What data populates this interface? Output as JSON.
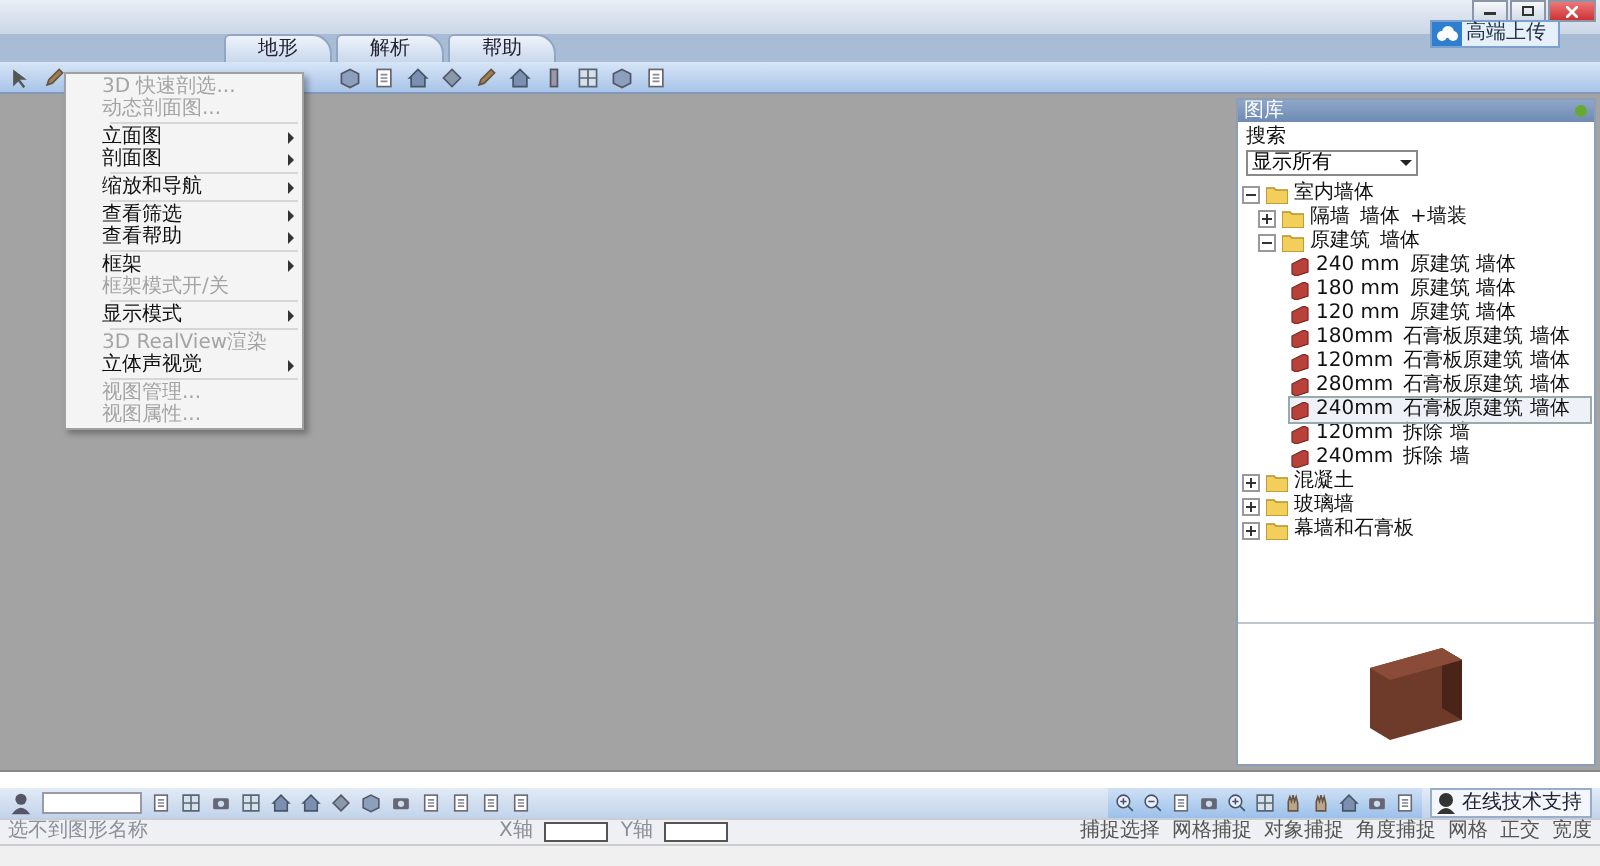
{
  "tabs": [
    {
      "label": "地形",
      "selected": false
    },
    {
      "label": "解析",
      "selected": false
    },
    {
      "label": "帮助",
      "selected": false
    }
  ],
  "upload_button": {
    "label": "高端上传"
  },
  "view_menu": {
    "groups": [
      [
        {
          "label": "3D 快速剖选...",
          "disabled": true,
          "submenu": false
        },
        {
          "label": "动态剖面图...",
          "disabled": true,
          "submenu": false
        }
      ],
      [
        {
          "label": "立面图",
          "disabled": false,
          "submenu": true
        },
        {
          "label": "剖面图",
          "disabled": false,
          "submenu": true
        }
      ],
      [
        {
          "label": "缩放和导航",
          "disabled": false,
          "submenu": true
        }
      ],
      [
        {
          "label": "查看筛选",
          "disabled": false,
          "submenu": true
        },
        {
          "label": "查看帮助",
          "disabled": false,
          "submenu": true
        }
      ],
      [
        {
          "label": "框架",
          "disabled": false,
          "submenu": true
        },
        {
          "label": "框架模式开/关",
          "disabled": true,
          "submenu": false
        }
      ],
      [
        {
          "label": "显示模式",
          "disabled": false,
          "submenu": true
        }
      ],
      [
        {
          "label": "3D RealView渲染",
          "disabled": true,
          "submenu": false
        },
        {
          "label": "立体声视觉",
          "disabled": false,
          "submenu": true
        }
      ],
      [
        {
          "label": "视图管理...",
          "disabled": true,
          "submenu": false
        },
        {
          "label": "视图属性...",
          "disabled": true,
          "submenu": false
        }
      ]
    ]
  },
  "library": {
    "title": "图库",
    "search_label": "搜索",
    "filter": {
      "value": "显示所有"
    },
    "tree": [
      {
        "kind": "folder",
        "label": "室内墙体",
        "expanded": true,
        "children": [
          {
            "kind": "folder",
            "label": "隔墙",
            "cells": [
              "墙体",
              "+墙装"
            ],
            "expanded": false
          },
          {
            "kind": "folder",
            "label": "原建筑",
            "cells": [
              "墙体"
            ],
            "expanded": true,
            "children": [
              {
                "kind": "wall",
                "label": "240 mm",
                "cells": [
                  "原建筑 墙体"
                ],
                "selected": false
              },
              {
                "kind": "wall",
                "label": "180 mm",
                "cells": [
                  "原建筑 墙体"
                ],
                "selected": false
              },
              {
                "kind": "wall",
                "label": "120 mm",
                "cells": [
                  "原建筑 墙体"
                ],
                "selected": false
              },
              {
                "kind": "wall",
                "label": "180mm",
                "cells": [
                  "石膏板原建筑 墙体"
                ],
                "selected": false
              },
              {
                "kind": "wall",
                "label": "120mm",
                "cells": [
                  "石膏板原建筑 墙体"
                ],
                "selected": false
              },
              {
                "kind": "wall",
                "label": "280mm",
                "cells": [
                  "石膏板原建筑 墙体"
                ],
                "selected": false
              },
              {
                "kind": "wall",
                "label": "240mm",
                "cells": [
                  "石膏板原建筑 墙体"
                ],
                "selected": true
              },
              {
                "kind": "wall",
                "label": "120mm",
                "cells": [
                  "拆除 墙"
                ],
                "selected": false
              },
              {
                "kind": "wall",
                "label": "240mm",
                "cells": [
                  "拆除 墙"
                ],
                "selected": false
              }
            ]
          }
        ]
      },
      {
        "kind": "folder",
        "label": "混凝土",
        "expanded": false
      },
      {
        "kind": "folder",
        "label": "玻璃墙",
        "expanded": false
      },
      {
        "kind": "folder",
        "label": "幕墙和石膏板",
        "expanded": false
      }
    ]
  },
  "support_button": {
    "label": "在线技术支持"
  },
  "status_bar": {
    "object_filter": "选不到图形名称",
    "x_label": "X轴",
    "y_label": "Y轴",
    "toggles": [
      "捕捉选择",
      "网格捕捉",
      "对象捕捉",
      "角度捕捉",
      "网格",
      "正交",
      "宽度"
    ]
  }
}
